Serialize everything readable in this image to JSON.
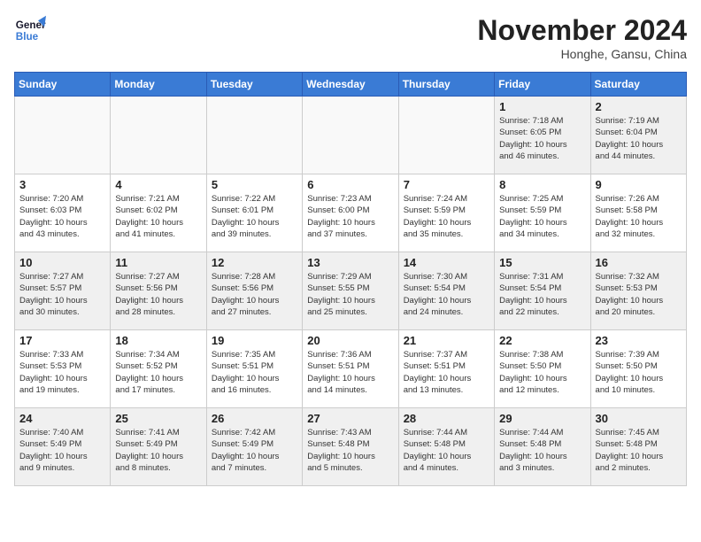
{
  "logo": {
    "line1": "General",
    "line2": "Blue"
  },
  "title": "November 2024",
  "location": "Honghe, Gansu, China",
  "days_of_week": [
    "Sunday",
    "Monday",
    "Tuesday",
    "Wednesday",
    "Thursday",
    "Friday",
    "Saturday"
  ],
  "weeks": [
    [
      {
        "day": "",
        "info": ""
      },
      {
        "day": "",
        "info": ""
      },
      {
        "day": "",
        "info": ""
      },
      {
        "day": "",
        "info": ""
      },
      {
        "day": "",
        "info": ""
      },
      {
        "day": "1",
        "info": "Sunrise: 7:18 AM\nSunset: 6:05 PM\nDaylight: 10 hours\nand 46 minutes."
      },
      {
        "day": "2",
        "info": "Sunrise: 7:19 AM\nSunset: 6:04 PM\nDaylight: 10 hours\nand 44 minutes."
      }
    ],
    [
      {
        "day": "3",
        "info": "Sunrise: 7:20 AM\nSunset: 6:03 PM\nDaylight: 10 hours\nand 43 minutes."
      },
      {
        "day": "4",
        "info": "Sunrise: 7:21 AM\nSunset: 6:02 PM\nDaylight: 10 hours\nand 41 minutes."
      },
      {
        "day": "5",
        "info": "Sunrise: 7:22 AM\nSunset: 6:01 PM\nDaylight: 10 hours\nand 39 minutes."
      },
      {
        "day": "6",
        "info": "Sunrise: 7:23 AM\nSunset: 6:00 PM\nDaylight: 10 hours\nand 37 minutes."
      },
      {
        "day": "7",
        "info": "Sunrise: 7:24 AM\nSunset: 5:59 PM\nDaylight: 10 hours\nand 35 minutes."
      },
      {
        "day": "8",
        "info": "Sunrise: 7:25 AM\nSunset: 5:59 PM\nDaylight: 10 hours\nand 34 minutes."
      },
      {
        "day": "9",
        "info": "Sunrise: 7:26 AM\nSunset: 5:58 PM\nDaylight: 10 hours\nand 32 minutes."
      }
    ],
    [
      {
        "day": "10",
        "info": "Sunrise: 7:27 AM\nSunset: 5:57 PM\nDaylight: 10 hours\nand 30 minutes."
      },
      {
        "day": "11",
        "info": "Sunrise: 7:27 AM\nSunset: 5:56 PM\nDaylight: 10 hours\nand 28 minutes."
      },
      {
        "day": "12",
        "info": "Sunrise: 7:28 AM\nSunset: 5:56 PM\nDaylight: 10 hours\nand 27 minutes."
      },
      {
        "day": "13",
        "info": "Sunrise: 7:29 AM\nSunset: 5:55 PM\nDaylight: 10 hours\nand 25 minutes."
      },
      {
        "day": "14",
        "info": "Sunrise: 7:30 AM\nSunset: 5:54 PM\nDaylight: 10 hours\nand 24 minutes."
      },
      {
        "day": "15",
        "info": "Sunrise: 7:31 AM\nSunset: 5:54 PM\nDaylight: 10 hours\nand 22 minutes."
      },
      {
        "day": "16",
        "info": "Sunrise: 7:32 AM\nSunset: 5:53 PM\nDaylight: 10 hours\nand 20 minutes."
      }
    ],
    [
      {
        "day": "17",
        "info": "Sunrise: 7:33 AM\nSunset: 5:53 PM\nDaylight: 10 hours\nand 19 minutes."
      },
      {
        "day": "18",
        "info": "Sunrise: 7:34 AM\nSunset: 5:52 PM\nDaylight: 10 hours\nand 17 minutes."
      },
      {
        "day": "19",
        "info": "Sunrise: 7:35 AM\nSunset: 5:51 PM\nDaylight: 10 hours\nand 16 minutes."
      },
      {
        "day": "20",
        "info": "Sunrise: 7:36 AM\nSunset: 5:51 PM\nDaylight: 10 hours\nand 14 minutes."
      },
      {
        "day": "21",
        "info": "Sunrise: 7:37 AM\nSunset: 5:51 PM\nDaylight: 10 hours\nand 13 minutes."
      },
      {
        "day": "22",
        "info": "Sunrise: 7:38 AM\nSunset: 5:50 PM\nDaylight: 10 hours\nand 12 minutes."
      },
      {
        "day": "23",
        "info": "Sunrise: 7:39 AM\nSunset: 5:50 PM\nDaylight: 10 hours\nand 10 minutes."
      }
    ],
    [
      {
        "day": "24",
        "info": "Sunrise: 7:40 AM\nSunset: 5:49 PM\nDaylight: 10 hours\nand 9 minutes."
      },
      {
        "day": "25",
        "info": "Sunrise: 7:41 AM\nSunset: 5:49 PM\nDaylight: 10 hours\nand 8 minutes."
      },
      {
        "day": "26",
        "info": "Sunrise: 7:42 AM\nSunset: 5:49 PM\nDaylight: 10 hours\nand 7 minutes."
      },
      {
        "day": "27",
        "info": "Sunrise: 7:43 AM\nSunset: 5:48 PM\nDaylight: 10 hours\nand 5 minutes."
      },
      {
        "day": "28",
        "info": "Sunrise: 7:44 AM\nSunset: 5:48 PM\nDaylight: 10 hours\nand 4 minutes."
      },
      {
        "day": "29",
        "info": "Sunrise: 7:44 AM\nSunset: 5:48 PM\nDaylight: 10 hours\nand 3 minutes."
      },
      {
        "day": "30",
        "info": "Sunrise: 7:45 AM\nSunset: 5:48 PM\nDaylight: 10 hours\nand 2 minutes."
      }
    ]
  ]
}
